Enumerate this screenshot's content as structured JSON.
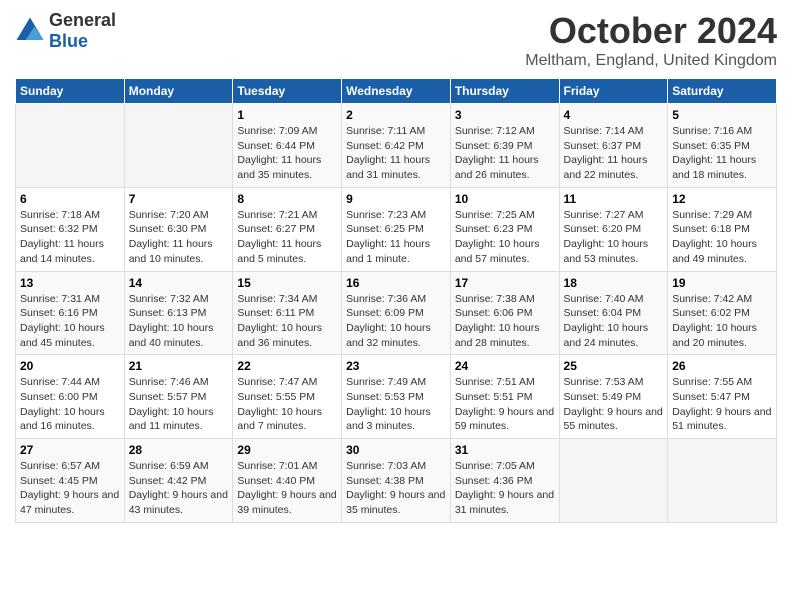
{
  "app": {
    "name_general": "General",
    "name_blue": "Blue"
  },
  "header": {
    "month_title": "October 2024",
    "location": "Meltham, England, United Kingdom"
  },
  "days_of_week": [
    "Sunday",
    "Monday",
    "Tuesday",
    "Wednesday",
    "Thursday",
    "Friday",
    "Saturday"
  ],
  "weeks": [
    [
      {
        "day": "",
        "content": ""
      },
      {
        "day": "",
        "content": ""
      },
      {
        "day": "1",
        "content": "Sunrise: 7:09 AM\nSunset: 6:44 PM\nDaylight: 11 hours and 35 minutes."
      },
      {
        "day": "2",
        "content": "Sunrise: 7:11 AM\nSunset: 6:42 PM\nDaylight: 11 hours and 31 minutes."
      },
      {
        "day": "3",
        "content": "Sunrise: 7:12 AM\nSunset: 6:39 PM\nDaylight: 11 hours and 26 minutes."
      },
      {
        "day": "4",
        "content": "Sunrise: 7:14 AM\nSunset: 6:37 PM\nDaylight: 11 hours and 22 minutes."
      },
      {
        "day": "5",
        "content": "Sunrise: 7:16 AM\nSunset: 6:35 PM\nDaylight: 11 hours and 18 minutes."
      }
    ],
    [
      {
        "day": "6",
        "content": "Sunrise: 7:18 AM\nSunset: 6:32 PM\nDaylight: 11 hours and 14 minutes."
      },
      {
        "day": "7",
        "content": "Sunrise: 7:20 AM\nSunset: 6:30 PM\nDaylight: 11 hours and 10 minutes."
      },
      {
        "day": "8",
        "content": "Sunrise: 7:21 AM\nSunset: 6:27 PM\nDaylight: 11 hours and 5 minutes."
      },
      {
        "day": "9",
        "content": "Sunrise: 7:23 AM\nSunset: 6:25 PM\nDaylight: 11 hours and 1 minute."
      },
      {
        "day": "10",
        "content": "Sunrise: 7:25 AM\nSunset: 6:23 PM\nDaylight: 10 hours and 57 minutes."
      },
      {
        "day": "11",
        "content": "Sunrise: 7:27 AM\nSunset: 6:20 PM\nDaylight: 10 hours and 53 minutes."
      },
      {
        "day": "12",
        "content": "Sunrise: 7:29 AM\nSunset: 6:18 PM\nDaylight: 10 hours and 49 minutes."
      }
    ],
    [
      {
        "day": "13",
        "content": "Sunrise: 7:31 AM\nSunset: 6:16 PM\nDaylight: 10 hours and 45 minutes."
      },
      {
        "day": "14",
        "content": "Sunrise: 7:32 AM\nSunset: 6:13 PM\nDaylight: 10 hours and 40 minutes."
      },
      {
        "day": "15",
        "content": "Sunrise: 7:34 AM\nSunset: 6:11 PM\nDaylight: 10 hours and 36 minutes."
      },
      {
        "day": "16",
        "content": "Sunrise: 7:36 AM\nSunset: 6:09 PM\nDaylight: 10 hours and 32 minutes."
      },
      {
        "day": "17",
        "content": "Sunrise: 7:38 AM\nSunset: 6:06 PM\nDaylight: 10 hours and 28 minutes."
      },
      {
        "day": "18",
        "content": "Sunrise: 7:40 AM\nSunset: 6:04 PM\nDaylight: 10 hours and 24 minutes."
      },
      {
        "day": "19",
        "content": "Sunrise: 7:42 AM\nSunset: 6:02 PM\nDaylight: 10 hours and 20 minutes."
      }
    ],
    [
      {
        "day": "20",
        "content": "Sunrise: 7:44 AM\nSunset: 6:00 PM\nDaylight: 10 hours and 16 minutes."
      },
      {
        "day": "21",
        "content": "Sunrise: 7:46 AM\nSunset: 5:57 PM\nDaylight: 10 hours and 11 minutes."
      },
      {
        "day": "22",
        "content": "Sunrise: 7:47 AM\nSunset: 5:55 PM\nDaylight: 10 hours and 7 minutes."
      },
      {
        "day": "23",
        "content": "Sunrise: 7:49 AM\nSunset: 5:53 PM\nDaylight: 10 hours and 3 minutes."
      },
      {
        "day": "24",
        "content": "Sunrise: 7:51 AM\nSunset: 5:51 PM\nDaylight: 9 hours and 59 minutes."
      },
      {
        "day": "25",
        "content": "Sunrise: 7:53 AM\nSunset: 5:49 PM\nDaylight: 9 hours and 55 minutes."
      },
      {
        "day": "26",
        "content": "Sunrise: 7:55 AM\nSunset: 5:47 PM\nDaylight: 9 hours and 51 minutes."
      }
    ],
    [
      {
        "day": "27",
        "content": "Sunrise: 6:57 AM\nSunset: 4:45 PM\nDaylight: 9 hours and 47 minutes."
      },
      {
        "day": "28",
        "content": "Sunrise: 6:59 AM\nSunset: 4:42 PM\nDaylight: 9 hours and 43 minutes."
      },
      {
        "day": "29",
        "content": "Sunrise: 7:01 AM\nSunset: 4:40 PM\nDaylight: 9 hours and 39 minutes."
      },
      {
        "day": "30",
        "content": "Sunrise: 7:03 AM\nSunset: 4:38 PM\nDaylight: 9 hours and 35 minutes."
      },
      {
        "day": "31",
        "content": "Sunrise: 7:05 AM\nSunset: 4:36 PM\nDaylight: 9 hours and 31 minutes."
      },
      {
        "day": "",
        "content": ""
      },
      {
        "day": "",
        "content": ""
      }
    ]
  ]
}
